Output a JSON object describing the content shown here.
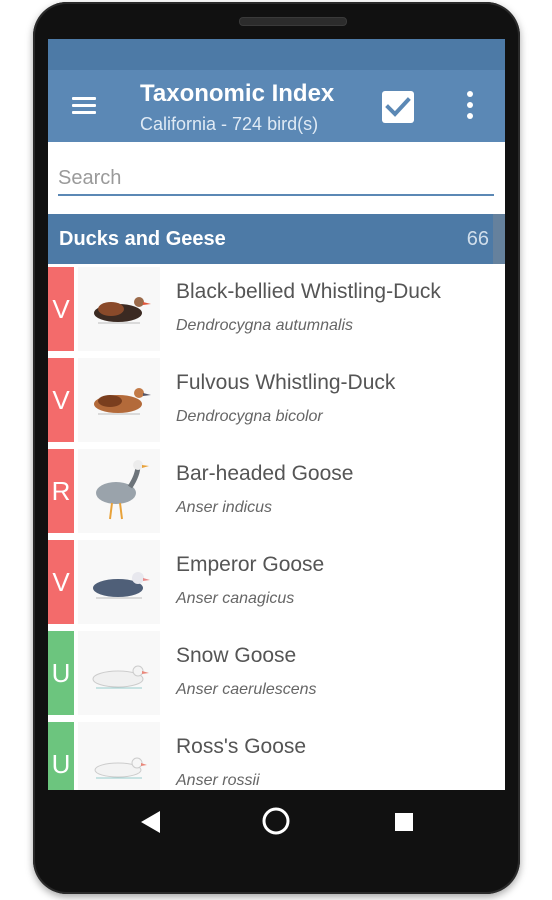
{
  "app_bar": {
    "title": "Taxonomic Index",
    "subtitle": "California - 724 bird(s)",
    "menu_icon": "hamburger-menu-icon",
    "check_icon": "checkbox-checked-icon",
    "more_icon": "more-vertical-icon"
  },
  "search": {
    "placeholder": "Search",
    "value": ""
  },
  "section": {
    "title": "Ducks and Geese",
    "count": "66"
  },
  "status_colors": {
    "V": "#f36b6b",
    "R": "#f36b6b",
    "U": "#6cc57e"
  },
  "colors": {
    "app_bar": "#5b88b5",
    "status_bar": "#4d7aa6",
    "section_header": "#4d7aa6"
  },
  "birds": [
    {
      "status": "V",
      "common_name": "Black-bellied Whistling-Duck",
      "scientific_name": "Dendrocygna autumnalis",
      "image": "duck-illustration"
    },
    {
      "status": "V",
      "common_name": "Fulvous Whistling-Duck",
      "scientific_name": "Dendrocygna bicolor",
      "image": "duck-illustration"
    },
    {
      "status": "R",
      "common_name": "Bar-headed Goose",
      "scientific_name": "Anser indicus",
      "image": "goose-illustration"
    },
    {
      "status": "V",
      "common_name": "Emperor Goose",
      "scientific_name": "Anser canagicus",
      "image": "goose-illustration"
    },
    {
      "status": "U",
      "common_name": "Snow Goose",
      "scientific_name": "Anser caerulescens",
      "image": "goose-illustration"
    },
    {
      "status": "U",
      "common_name": "Ross's Goose",
      "scientific_name": "Anser rossii",
      "image": "goose-illustration"
    }
  ],
  "nav": {
    "back_icon": "back-triangle-icon",
    "home_icon": "home-circle-icon",
    "recent_icon": "recent-apps-square-icon"
  }
}
